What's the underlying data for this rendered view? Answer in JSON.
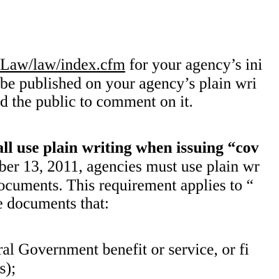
{
  "document": {
    "paragraph_1": {
      "line_1_link": "Law/law/index.cfm",
      "line_1_rest": " for your agency’s ini",
      "line_2": "be published on your agency’s plain wri",
      "line_3": "d the public to comment on it."
    },
    "paragraph_2": {
      "heading": "all use plain writing when issuing “cov",
      "line_2": "ber 13, 2011, agencies must use plain wr",
      "line_3": "ocuments.  This requirement applies to “",
      "line_4": "e documents that:"
    },
    "paragraph_3": {
      "line_1": "eral Government benefit or service, or fi",
      "line_2": "ns);"
    }
  }
}
